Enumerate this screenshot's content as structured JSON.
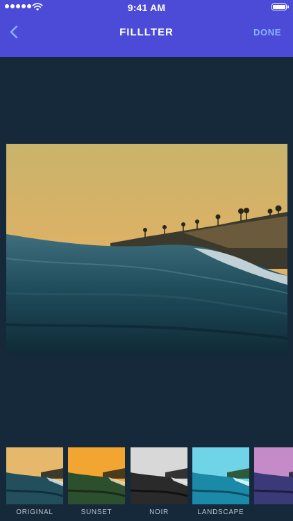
{
  "status": {
    "time": "9:41 AM"
  },
  "nav": {
    "title": "FILLLTER",
    "done_label": "DONE"
  },
  "filters": [
    {
      "label": "ORIGINAL"
    },
    {
      "label": "SUNSET"
    },
    {
      "label": "NOIR"
    },
    {
      "label": "LANDSCAPE"
    },
    {
      "label": ""
    }
  ],
  "colors": {
    "header": "#4b4bd8",
    "background": "#16293a",
    "accent": "#8ab2ff"
  }
}
